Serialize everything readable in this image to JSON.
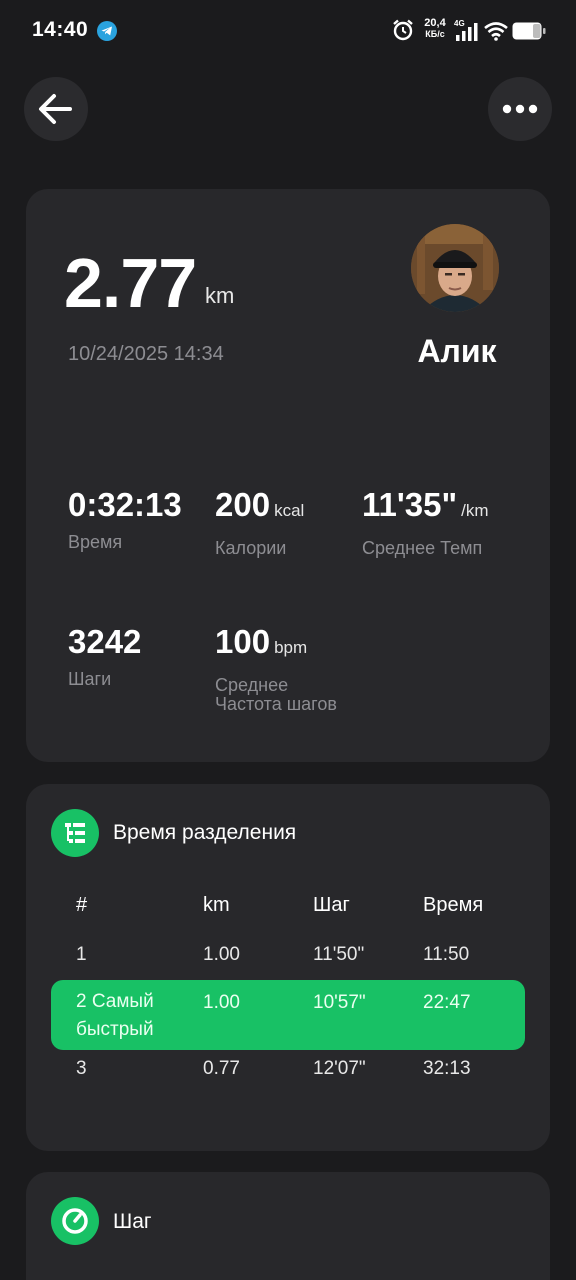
{
  "status_bar": {
    "time": "14:40",
    "net_speed_value": "20,4",
    "net_speed_unit": "КБ/с",
    "network_type": "4G",
    "icons": [
      "telegram-icon",
      "alarm-icon",
      "signal-icon",
      "wifi-icon",
      "battery-icon"
    ]
  },
  "nav": {
    "back_icon": "arrow-left-icon",
    "more_icon": "more-dots-icon"
  },
  "summary": {
    "distance": "2.77",
    "distance_unit": "km",
    "date_time": "10/24/2025 14:34",
    "user_name": "Алик",
    "stats": [
      {
        "value": "0:32:13",
        "unit": "",
        "label": "Время"
      },
      {
        "value": "200",
        "unit": "kcal",
        "label": "Калории"
      },
      {
        "value": "11'35\"",
        "unit": "/km",
        "label": "Среднее Темп"
      },
      {
        "value": "3242",
        "unit": "",
        "label": "Шаги"
      },
      {
        "value": "100",
        "unit": "bpm",
        "label": "Среднее\nЧастота шагов"
      }
    ]
  },
  "splits": {
    "title": "Время разделения",
    "icon": "splits-list-icon",
    "columns": [
      "#",
      "km",
      "Шаг",
      "Время"
    ],
    "rows": [
      {
        "index": "1",
        "km": "1.00",
        "pace": "11'50\"",
        "time": "11:50",
        "highlight": false
      },
      {
        "index": "2  Самый быстрый",
        "km": "1.00",
        "pace": "10'57\"",
        "time": "22:47",
        "highlight": true
      },
      {
        "index": "3",
        "km": "0.77",
        "pace": "12'07\"",
        "time": "32:13",
        "highlight": false
      }
    ]
  },
  "pace": {
    "title": "Шаг",
    "icon": "speedometer-icon"
  },
  "colors": {
    "background": "#1b1b1d",
    "card": "#28282b",
    "accent_green": "#18c165",
    "muted_text": "#8d8d92"
  }
}
